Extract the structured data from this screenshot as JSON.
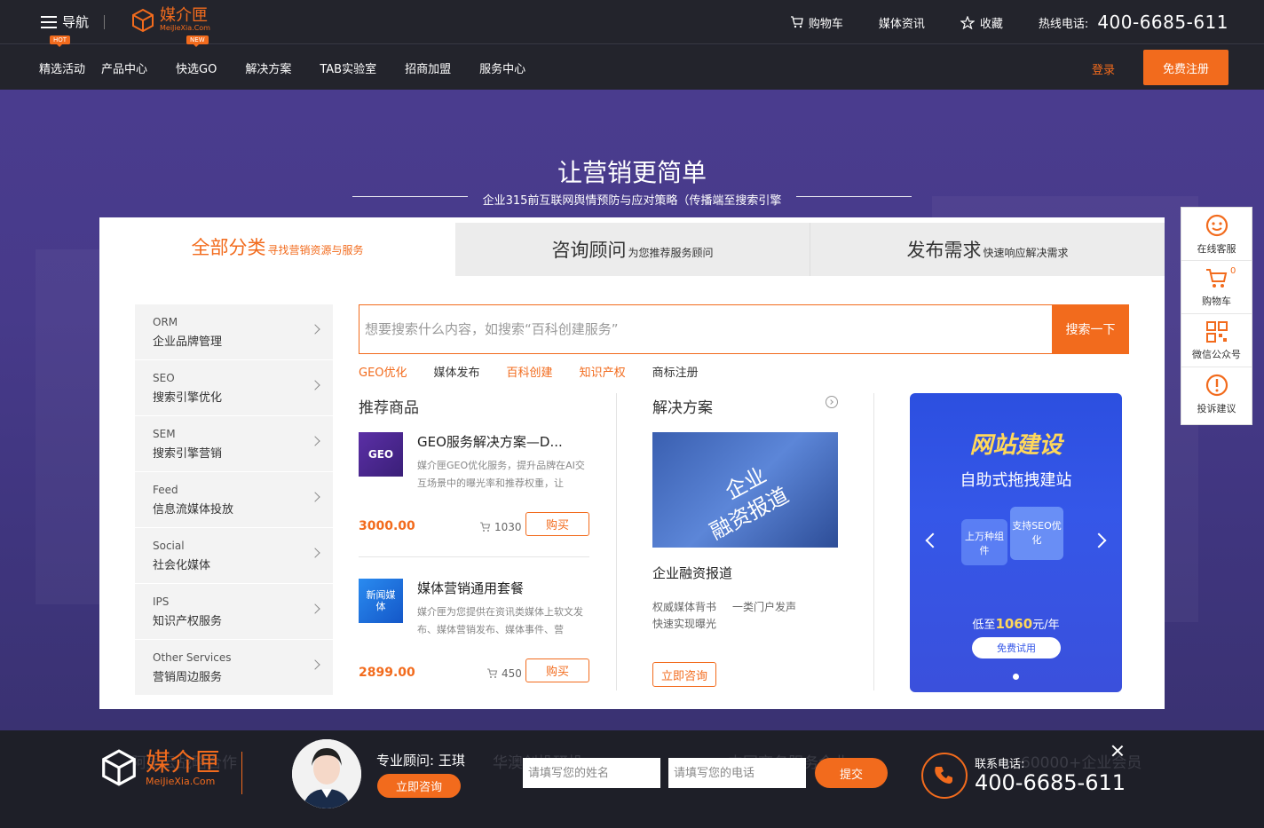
{
  "header": {
    "nav_label": "导航",
    "logo_name": "媒介匣",
    "logo_sub": "MeiJieXia.Com",
    "cart": "购物车",
    "news": "媒体资讯",
    "favorite": "收藏",
    "hotline_label": "热线电话:",
    "hotline_number": "400-6685-611"
  },
  "mainnav": {
    "items": [
      {
        "label": "精选活动",
        "tag": "HOT"
      },
      {
        "label": "产品中心",
        "tag": ""
      },
      {
        "label": "快选GO",
        "tag": "NEW"
      },
      {
        "label": "解决方案",
        "tag": ""
      },
      {
        "label": "TAB实验室",
        "tag": ""
      },
      {
        "label": "招商加盟",
        "tag": ""
      },
      {
        "label": "服务中心",
        "tag": ""
      }
    ],
    "login": "登录",
    "register": "免费注册"
  },
  "hero": {
    "title": "让营销更简单",
    "subtitle": "企业315前互联网舆情预防与应对策略（传播端至搜索引擎"
  },
  "tabs": [
    {
      "big": "全部分类",
      "small": "寻找营销资源与服务"
    },
    {
      "big": "咨询顾问",
      "small": "为您推荐服务顾问"
    },
    {
      "big": "发布需求",
      "small": "快速响应解决需求"
    }
  ],
  "categories": [
    {
      "en": "ORM",
      "zh": "企业品牌管理"
    },
    {
      "en": "SEO",
      "zh": "搜索引擎优化"
    },
    {
      "en": "SEM",
      "zh": "搜索引擎营销"
    },
    {
      "en": "Feed",
      "zh": "信息流媒体投放"
    },
    {
      "en": "Social",
      "zh": "社会化媒体"
    },
    {
      "en": "IPS",
      "zh": "知识产权服务"
    },
    {
      "en": "Other Services",
      "zh": "营销周边服务"
    }
  ],
  "search": {
    "placeholder": "想要搜索什么内容，如搜索“百科创建服务”",
    "button": "搜索一下",
    "hotwords": [
      "GEO优化",
      "媒体发布",
      "百科创建",
      "知识产权",
      "商标注册"
    ]
  },
  "recommend": {
    "title": "推荐商品",
    "products": [
      {
        "thumb_text": "GEO",
        "name": "GEO服务解决方案—D...",
        "desc": "媒介匣GEO优化服务，提升品牌在AI交互场景中的曝光率和推荐权重，让",
        "price": "3000.00",
        "sold": "1030",
        "buy": "购买"
      },
      {
        "thumb_text": "新闻媒体",
        "name": "媒体营销通用套餐",
        "desc": "媒介匣为您提供在资讯类媒体上软文发布、媒体营销发布、媒体事件、营",
        "price": "2899.00",
        "sold": "450",
        "buy": "购买"
      }
    ]
  },
  "solution": {
    "title": "解决方案",
    "image_text_1": "企业",
    "image_text_2": "融资报道",
    "name": "企业融资报道",
    "tags": [
      "权威媒体背书",
      "一类门户发声",
      "快速实现曝光"
    ],
    "consult": "立即咨询"
  },
  "banner": {
    "title": "网站建设",
    "subtitle": "自助式拖拽建站",
    "chip1": "上万种组件",
    "chip2": "支持SEO优化",
    "price_prefix": "低至",
    "price_value": "1060",
    "price_suffix": "元/年",
    "trial": "免费试用"
  },
  "float": {
    "service": "在线客服",
    "cart": "购物车",
    "cart_count": "0",
    "wechat": "微信公众号",
    "complaint": "投诉建议"
  },
  "dock": {
    "logo_name": "媒介匣",
    "logo_sub": "MeiJieXia.Com",
    "ghost_texts": [
      "阿里云战略合作",
      "华澳创投研投",
      "中国商务服务企业",
      "60000+企业会员"
    ],
    "advisor_label": "专业顾问:",
    "advisor_name": "王琪",
    "consult": "立即咨询",
    "name_placeholder": "请填写您的姓名",
    "phone_placeholder": "请填写您的电话",
    "submit": "提交",
    "contact_label": "联系电话:",
    "contact_number": "400-6685-611"
  },
  "colors": {
    "accent": "#f26b1d",
    "header_bg": "#23242c",
    "hero_bg": "#473a8a",
    "banner_bg": "#3557e8"
  }
}
